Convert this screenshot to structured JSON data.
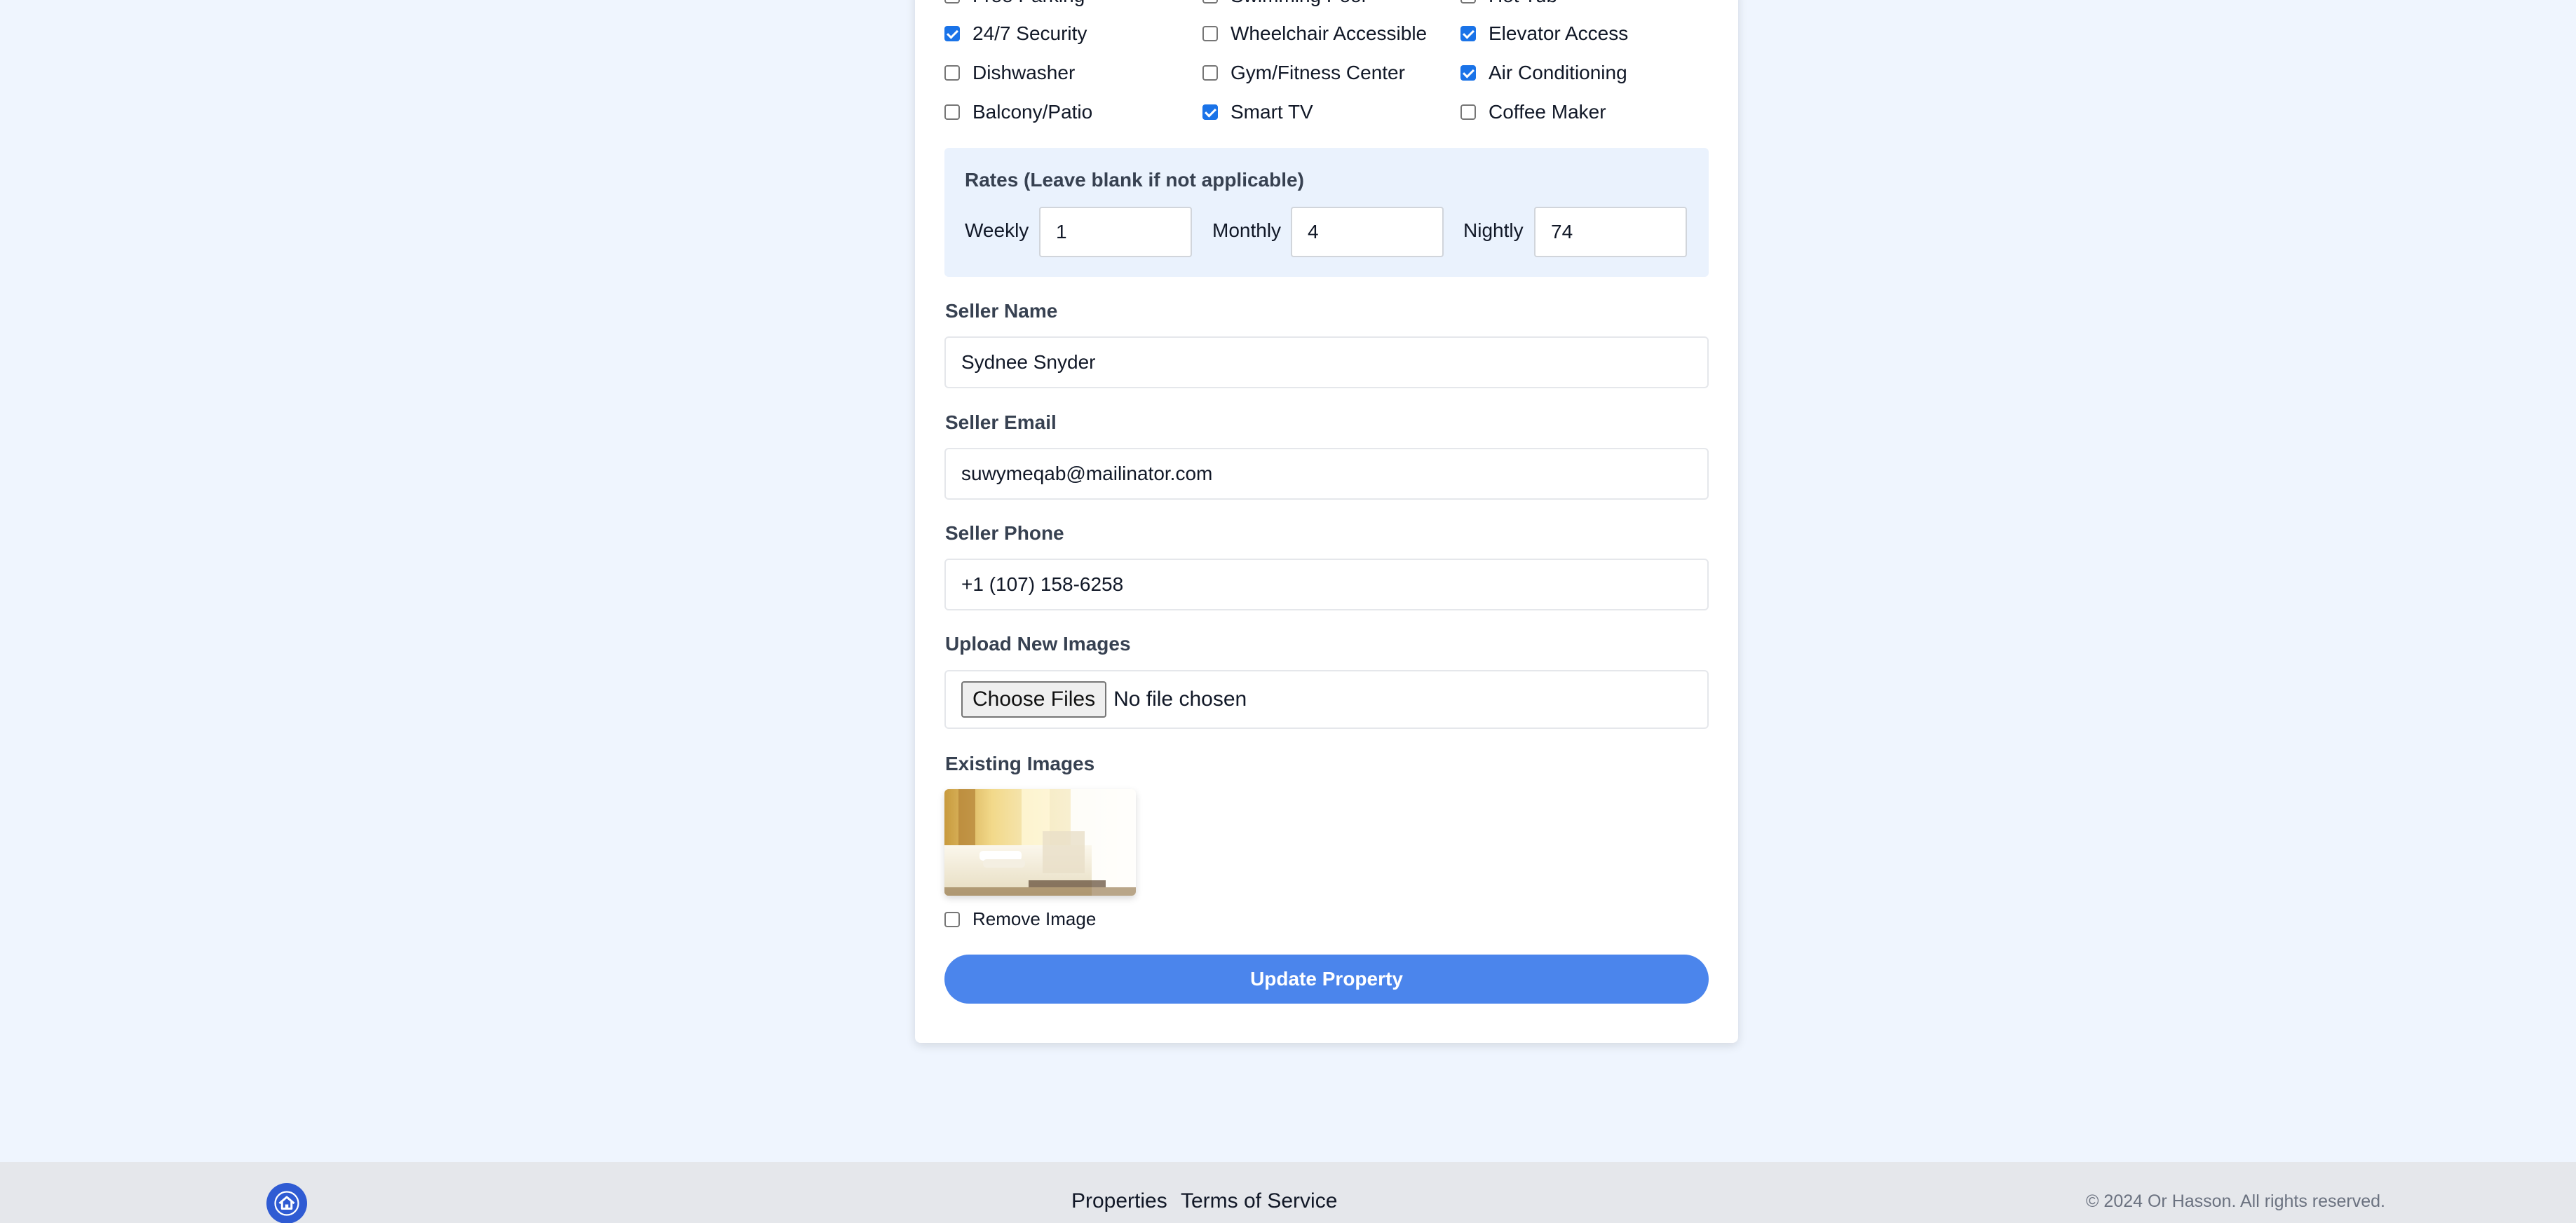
{
  "amenities": {
    "partial_top_row": [
      "Free Parking",
      "Swimming Pool",
      "Hot Tub"
    ],
    "rows": [
      [
        {
          "label": "24/7 Security",
          "checked": true
        },
        {
          "label": "Wheelchair Accessible",
          "checked": false
        },
        {
          "label": "Elevator Access",
          "checked": true
        }
      ],
      [
        {
          "label": "Dishwasher",
          "checked": false
        },
        {
          "label": "Gym/Fitness Center",
          "checked": false
        },
        {
          "label": "Air Conditioning",
          "checked": true
        }
      ],
      [
        {
          "label": "Balcony/Patio",
          "checked": false
        },
        {
          "label": "Smart TV",
          "checked": true
        },
        {
          "label": "Coffee Maker",
          "checked": false
        }
      ]
    ]
  },
  "rates": {
    "title": "Rates (Leave blank if not applicable)",
    "weekly_label": "Weekly",
    "weekly_value": "1",
    "monthly_label": "Monthly",
    "monthly_value": "4",
    "nightly_label": "Nightly",
    "nightly_value": "74"
  },
  "seller": {
    "name_label": "Seller Name",
    "name_value": "Sydnee Snyder",
    "email_label": "Seller Email",
    "email_value": "suwymeqab@mailinator.com",
    "phone_label": "Seller Phone",
    "phone_value": "+1 (107) 158-6258"
  },
  "upload": {
    "label": "Upload New Images",
    "button": "Choose Files",
    "status": "No file chosen"
  },
  "existing": {
    "label": "Existing Images",
    "remove_label": "Remove Image",
    "remove_checked": false
  },
  "submit_label": "Update Property",
  "footer": {
    "logo_icon": "home-icon",
    "links": [
      "Properties",
      "Terms of Service"
    ],
    "copyright": "© 2024 Or Hasson. All rights reserved."
  },
  "colors": {
    "accent": "#4b85ec",
    "checkbox": "#1a73e8",
    "logo": "#2f5bd3",
    "background": "#eff5fe"
  }
}
